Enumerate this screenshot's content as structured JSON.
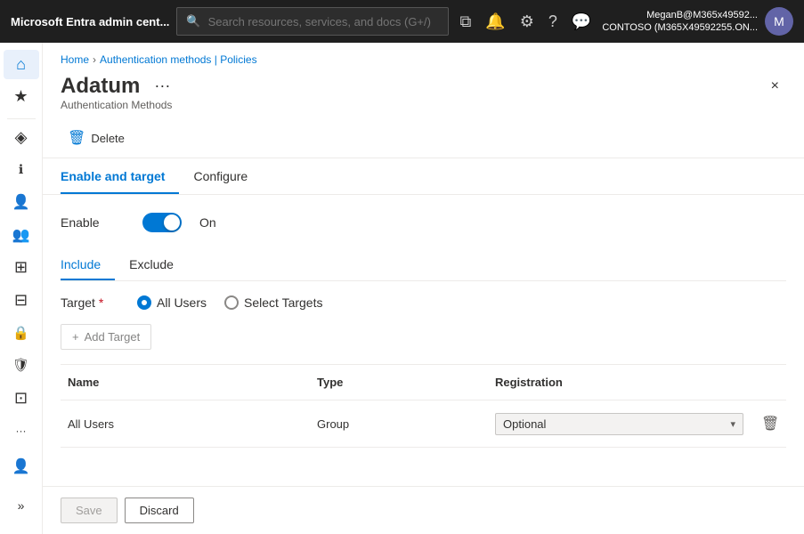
{
  "topbar": {
    "logo": "Microsoft Entra admin cent...",
    "search_placeholder": "Search resources, services, and docs (G+/)",
    "user_name": "MeganB@M365x49592...",
    "user_org": "CONTOSO (M365X49592255.ON...",
    "icons": [
      "portal-icon",
      "notification-icon",
      "settings-icon",
      "help-icon",
      "feedback-icon"
    ]
  },
  "breadcrumb": {
    "home": "Home",
    "section": "Authentication methods | Policies"
  },
  "page": {
    "title": "Adatum",
    "subtitle": "Authentication Methods",
    "close_label": "×",
    "more_label": "···"
  },
  "actions": {
    "delete_label": "Delete"
  },
  "tabs": [
    {
      "id": "enable-target",
      "label": "Enable and target",
      "active": true
    },
    {
      "id": "configure",
      "label": "Configure",
      "active": false
    }
  ],
  "enable": {
    "label": "Enable",
    "state_label": "On"
  },
  "subtabs": [
    {
      "id": "include",
      "label": "Include",
      "active": true
    },
    {
      "id": "exclude",
      "label": "Exclude",
      "active": false
    }
  ],
  "target": {
    "label": "Target",
    "required": "*",
    "options": [
      {
        "id": "all-users",
        "label": "All Users",
        "selected": true
      },
      {
        "id": "select-targets",
        "label": "Select Targets",
        "selected": false
      }
    ]
  },
  "add_target": {
    "label": "Add Target",
    "plus": "+"
  },
  "table": {
    "headers": [
      "Name",
      "Type",
      "Registration"
    ],
    "rows": [
      {
        "name": "All Users",
        "type": "Group",
        "registration": "Optional"
      }
    ]
  },
  "footer": {
    "save_label": "Save",
    "discard_label": "Discard"
  },
  "sidebar": {
    "items": [
      {
        "id": "home",
        "icon": "⌂",
        "active": true
      },
      {
        "id": "favorites",
        "icon": "★",
        "active": false
      },
      {
        "id": "divider",
        "icon": "",
        "active": false
      },
      {
        "id": "dashboard",
        "icon": "◈",
        "active": false
      },
      {
        "id": "info",
        "icon": "ℹ",
        "active": false
      },
      {
        "id": "users",
        "icon": "👤",
        "active": false
      },
      {
        "id": "groups",
        "icon": "👥",
        "active": false
      },
      {
        "id": "apps",
        "icon": "⊞",
        "active": false
      },
      {
        "id": "grid",
        "icon": "⊟",
        "active": false
      },
      {
        "id": "lock",
        "icon": "🔒",
        "active": false
      },
      {
        "id": "shield",
        "icon": "🛡",
        "active": false
      },
      {
        "id": "reports",
        "icon": "⊡",
        "active": false
      },
      {
        "id": "more",
        "icon": "···",
        "active": false
      },
      {
        "id": "account",
        "icon": "👤",
        "active": false
      },
      {
        "id": "expand",
        "icon": "»",
        "active": false
      }
    ]
  }
}
